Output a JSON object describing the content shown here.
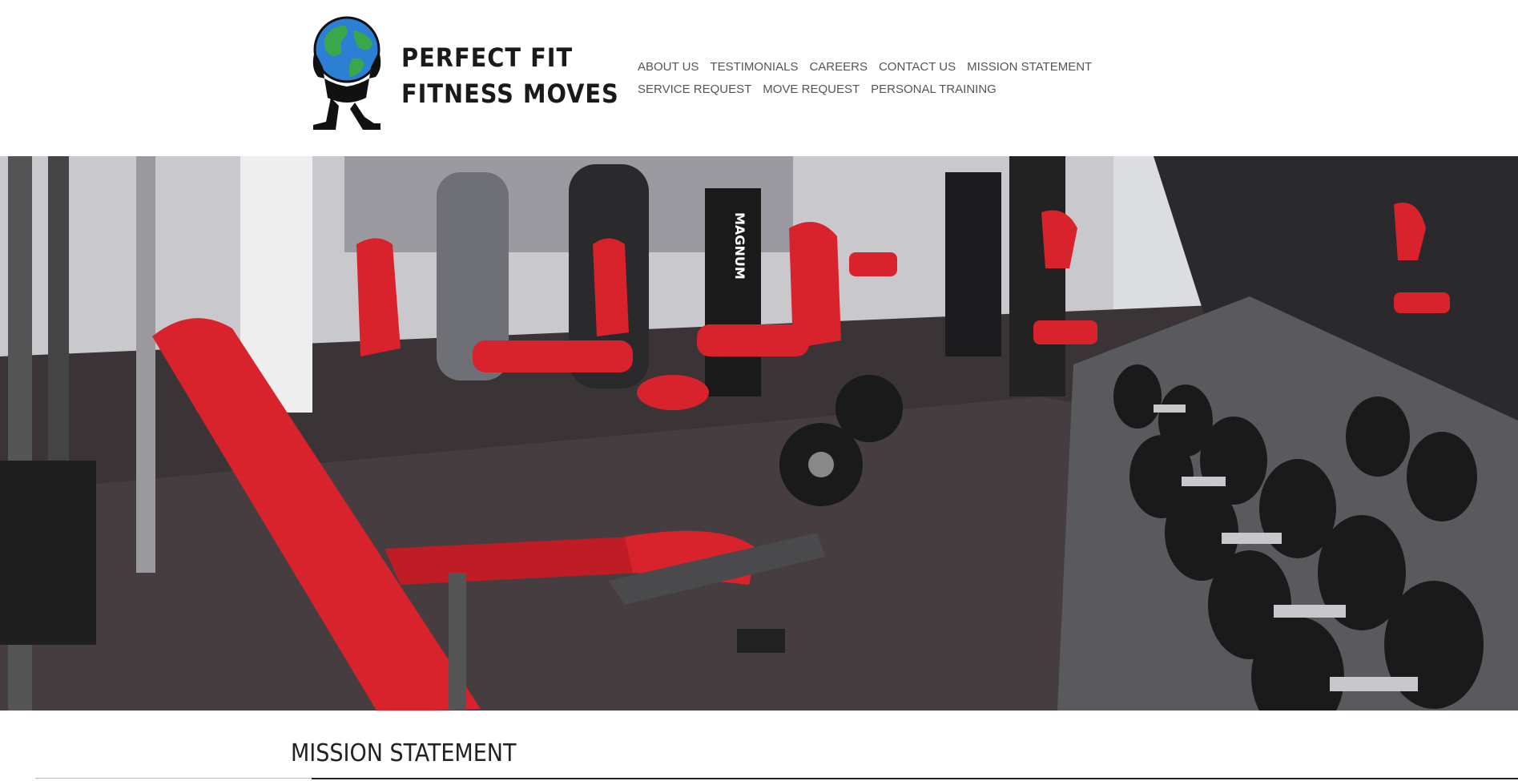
{
  "site": {
    "title": "PERFECT FIT FITNESS MOVES"
  },
  "nav": {
    "items": [
      {
        "label": "ABOUT US"
      },
      {
        "label": "TESTIMONIALS"
      },
      {
        "label": "CAREERS"
      },
      {
        "label": "CONTACT US"
      },
      {
        "label": "MISSION STATEMENT"
      },
      {
        "label": "SERVICE REQUEST"
      },
      {
        "label": "MOVE REQUEST"
      },
      {
        "label": "PERSONAL TRAINING"
      }
    ]
  },
  "main": {
    "heading": "MISSION STATEMENT"
  },
  "hero": {
    "image_label": "MAGNUM"
  },
  "colors": {
    "accent_red": "#d8222c",
    "floor": "#3a3436",
    "equipment_dark": "#1e1e1e",
    "equipment_grey": "#8a8c90"
  }
}
